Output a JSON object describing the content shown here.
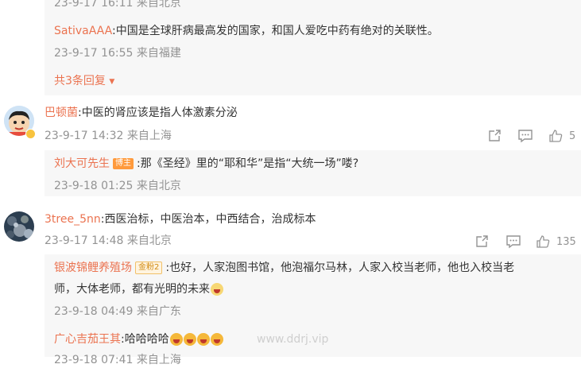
{
  "sub_replies_1": {
    "top_meta": "23-9-17 16:11 来自北京",
    "items": [
      {
        "author": "SativaAAA",
        "text": ":中国是全球肝病最高发的国家，和国人爱吃中药有绝对的关联性。",
        "meta": "23-9-17 16:55 来自福建"
      }
    ],
    "more": "共3条回复"
  },
  "comments": [
    {
      "author": "巴顿菌",
      "text": ":中医的肾应该是指人体激素分泌",
      "meta": "23-9-17 14:32 来自上海",
      "like_count": "5",
      "replies": [
        {
          "author": "刘大可先生",
          "badge": "博主",
          "text": ":那《圣经》里的“耶和华”是指“大统一场”喽?",
          "meta": "23-9-18 01:25 来自北京"
        }
      ]
    },
    {
      "author": "3tree_5nn",
      "text": ":西医治标，中医治本，中西结合，治成标本",
      "meta": "23-9-17 14:48 来自北京",
      "like_count": "135",
      "replies": [
        {
          "author": "银波锦鲤养殖场",
          "badge": "金粉2",
          "text_line1": ":也好，人家泡图书馆，他泡福尔马林，人家入校当老师，他也入校当老",
          "text_line2": "师，大体老师，都有光明的未来",
          "meta": "23-9-18 04:49 来自广东"
        },
        {
          "author": "广心吉茄王其",
          "text": ":哈哈哈哈",
          "meta": "23-9-18 07:41 来自上海"
        }
      ]
    }
  ],
  "watermark": "www.ddrj.vip",
  "icons": {
    "share": "share-icon",
    "comment": "comment-icon",
    "like": "like-icon"
  },
  "colors": {
    "name": "#eb7350",
    "meta": "#939393",
    "reply_bg": "#f7f7f7"
  }
}
